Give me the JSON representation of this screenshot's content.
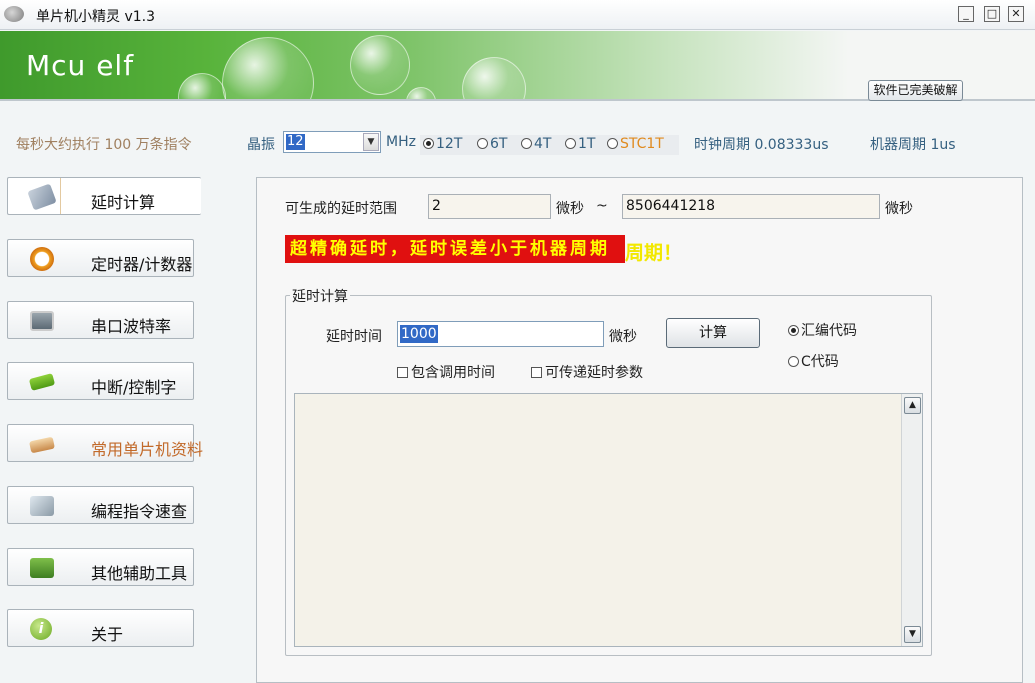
{
  "window": {
    "title": "单片机小精灵  v1.3",
    "min": "_",
    "max": "□",
    "close": "✕"
  },
  "banner": {
    "logo": "Mcu elf",
    "crack_button": "软件已完美破解"
  },
  "info": {
    "speed": "每秒大约执行 100 万条指令",
    "crystal_label": "晶振",
    "crystal_value": "12",
    "crystal_unit": "MHz",
    "modes": [
      {
        "label": "12T",
        "selected": true
      },
      {
        "label": "6T",
        "selected": false
      },
      {
        "label": "4T",
        "selected": false
      },
      {
        "label": "1T",
        "selected": false
      },
      {
        "label": "STC1T",
        "selected": false
      }
    ],
    "clock_period": "时钟周期 0.08333us",
    "machine_period": "机器周期 1us"
  },
  "sidebar": {
    "items": [
      {
        "label": "延时计算",
        "icon": "calculator-icon"
      },
      {
        "label": "定时器/计数器",
        "icon": "alarm-clock-icon"
      },
      {
        "label": "串口波特率",
        "icon": "monitor-icon"
      },
      {
        "label": "中断/控制字",
        "icon": "chip-icon"
      },
      {
        "label": "常用单片机资料",
        "icon": "book-icon"
      },
      {
        "label": "编程指令速查",
        "icon": "magnifier-icon"
      },
      {
        "label": "其他辅助工具",
        "icon": "toolbox-icon"
      },
      {
        "label": "关于",
        "icon": "info-icon"
      }
    ]
  },
  "main": {
    "range_label": "可生成的延时范围",
    "range_min": "2",
    "range_unit_min": "微秒",
    "range_sep": "~",
    "range_max": "8506441218",
    "range_unit_max": "微秒",
    "precision_banner": "超精确延时，延时误差小于机器周期",
    "precision_tail": "周期！",
    "group_title": "延时计算",
    "delay_label": "延时时间",
    "delay_value": "1000",
    "delay_unit": "微秒",
    "calc_button": "计算",
    "include_call": "包含调用时间",
    "pass_param": "可传递延时参数",
    "asm_code": "汇编代码",
    "c_code": "C代码",
    "scroll_up": "▲",
    "scroll_down": "▼"
  },
  "colors": {
    "accent": "#3169c6",
    "banner_green": "#58b33b",
    "alert_red": "#e01010",
    "alert_yellow": "#ffff00"
  }
}
